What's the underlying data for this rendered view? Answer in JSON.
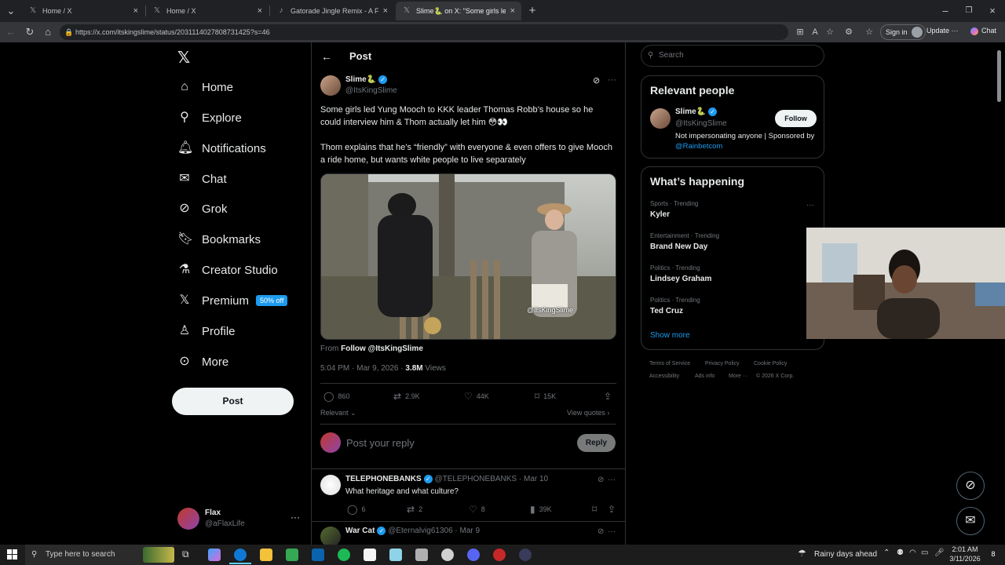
{
  "browser": {
    "tabs": [
      {
        "label": "Home / X",
        "icon": "x-icon",
        "active": false
      },
      {
        "label": "Home / X",
        "icon": "x-icon",
        "active": false
      },
      {
        "label": "Gatorade Jingle Remix - A Fun Tw...",
        "icon": "tiktok-icon",
        "active": false
      },
      {
        "label": "Slime🐍 on X: \"Some girls led Yun...",
        "icon": "x-icon",
        "active": true
      }
    ],
    "url": "https://x.com/itskingslime/status/2031114027808731425?s=46",
    "sign_in": "Sign in",
    "update": "Update",
    "chat": "Chat"
  },
  "nav": {
    "items": [
      {
        "label": "Home",
        "icon": "home-icon"
      },
      {
        "label": "Explore",
        "icon": "search-icon"
      },
      {
        "label": "Notifications",
        "icon": "bell-icon"
      },
      {
        "label": "Chat",
        "icon": "mail-icon"
      },
      {
        "label": "Grok",
        "icon": "grok-icon"
      },
      {
        "label": "Bookmarks",
        "icon": "bookmark-icon"
      },
      {
        "label": "Creator Studio",
        "icon": "flask-icon"
      },
      {
        "label": "Premium",
        "icon": "x-icon"
      },
      {
        "label": "Profile",
        "icon": "person-icon"
      },
      {
        "label": "More",
        "icon": "more-circle-icon"
      }
    ],
    "premium_badge": "50% off",
    "post_label": "Post",
    "account": {
      "name": "Flax",
      "handle": "@aFlaxLife"
    }
  },
  "post": {
    "header": "Post",
    "author": {
      "name": "Slime🐍",
      "handle": "@ItsKingSlime"
    },
    "text1": "Some girls led Yung Mooch to KKK leader Thomas Robb’s house so he could interview him & Thom actually let him 😳👀",
    "text2": "Thom explains that he’s “friendly” with everyone & even offers to give Mooch a ride home, but wants white people to live separately",
    "video_overlay": "@ItsKingSlime",
    "from_label": "From",
    "from_link": "Follow @ItsKingSlime",
    "timestamp": "5:04 PM · Mar 9, 2026 ·",
    "views_count": "3.8M",
    "views_label": "Views",
    "stats": {
      "replies": "860",
      "reposts": "2.9K",
      "likes": "44K",
      "bookmarks": "15K"
    },
    "relevant_label": "Relevant",
    "view_quotes": "View quotes",
    "reply_placeholder": "Post your reply",
    "reply_button": "Reply"
  },
  "replies": [
    {
      "name": "TELEPHONEBANKS",
      "handle": "@TELEPHONEBANKS",
      "date": "· Mar 10",
      "text": "What heritage and what culture?",
      "stats": {
        "replies": "6",
        "reposts": "2",
        "likes": "8",
        "views": "39K"
      }
    },
    {
      "name": "War Cat",
      "handle": "@Eternalvig61306",
      "date": "· Mar 9"
    }
  ],
  "sidebar": {
    "search_placeholder": "Search",
    "relevant_title": "Relevant people",
    "person": {
      "name": "Slime🐍",
      "handle": "@ItsKingSlime",
      "bio_text": "Not impersonating anyone | Sponsored by",
      "bio_link": "@Rainbetcom",
      "follow": "Follow"
    },
    "happening_title": "What’s happening",
    "trends": [
      {
        "category": "Sports · Trending",
        "name": "Kyler"
      },
      {
        "category": "Entertainment · Trending",
        "name": "Brand New Day"
      },
      {
        "category": "Politics · Trending",
        "name": "Lindsey Graham"
      },
      {
        "category": "Politics · Trending",
        "name": "Ted Cruz"
      }
    ],
    "show_more": "Show more",
    "footer": [
      "Terms of Service",
      "Privacy Policy",
      "Cookie Policy",
      "Accessibility",
      "Ads info",
      "More ···",
      "© 2026 X Corp."
    ]
  },
  "taskbar": {
    "search_placeholder": "Type here to search",
    "weather": "Rainy days ahead",
    "time": "2:01 AM",
    "date": "3/11/2026",
    "notif_count": "8"
  },
  "colors": {
    "accent": "#1d9bf0",
    "background": "#000000",
    "border": "#2f3336",
    "muted": "#71767b"
  }
}
